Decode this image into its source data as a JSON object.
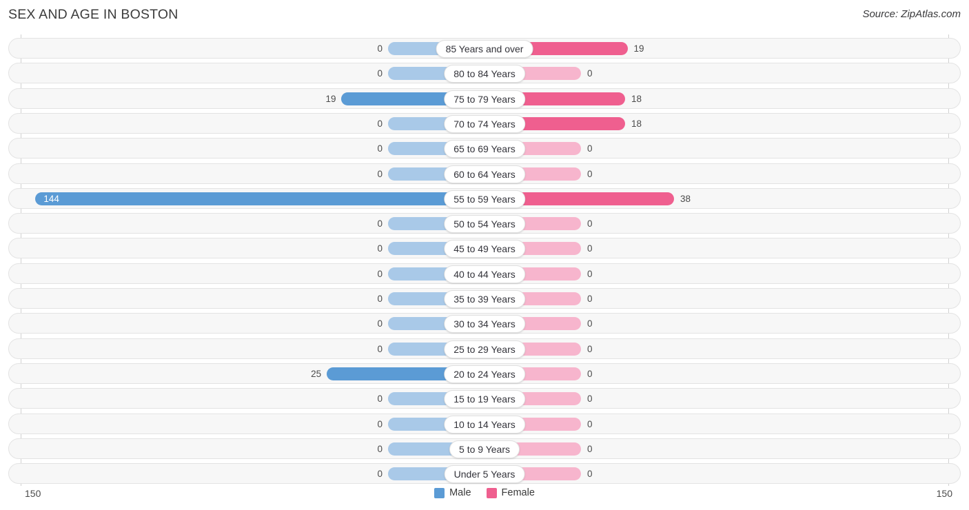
{
  "header": {
    "title": "SEX AND AGE IN BOSTON",
    "source": "Source: ZipAtlas.com"
  },
  "axis": {
    "left_label": "150",
    "right_label": "150",
    "max": 150
  },
  "legend": [
    {
      "label": "Male",
      "color": "#5b9bd5",
      "name": "legend-male"
    },
    {
      "label": "Female",
      "color": "#ef5f8f",
      "name": "legend-female"
    }
  ],
  "colors": {
    "male_strong": "#5b9bd5",
    "male_light": "#a9c9e8",
    "female_strong": "#ef5f8f",
    "female_light": "#f7b5cd",
    "row_bg": "#f7f7f7",
    "row_border": "#e3e3e3",
    "axis": "#d0d0d0"
  },
  "chart_data": {
    "type": "bar",
    "subtype": "population-pyramid",
    "title": "SEX AND AGE IN BOSTON",
    "xlabel": "",
    "ylabel": "",
    "xlim": [
      -150,
      150
    ],
    "grid": false,
    "legend_position": "bottom-center",
    "categories": [
      "85 Years and over",
      "80 to 84 Years",
      "75 to 79 Years",
      "70 to 74 Years",
      "65 to 69 Years",
      "60 to 64 Years",
      "55 to 59 Years",
      "50 to 54 Years",
      "45 to 49 Years",
      "40 to 44 Years",
      "35 to 39 Years",
      "30 to 34 Years",
      "25 to 29 Years",
      "20 to 24 Years",
      "15 to 19 Years",
      "10 to 14 Years",
      "5 to 9 Years",
      "Under 5 Years"
    ],
    "series": [
      {
        "name": "Male",
        "color": "#5b9bd5",
        "values": [
          0,
          0,
          19,
          0,
          0,
          0,
          144,
          0,
          0,
          0,
          0,
          0,
          0,
          25,
          0,
          0,
          0,
          0
        ]
      },
      {
        "name": "Female",
        "color": "#ef5f8f",
        "values": [
          19,
          0,
          18,
          18,
          0,
          0,
          38,
          0,
          0,
          0,
          0,
          0,
          0,
          0,
          0,
          0,
          0,
          0
        ]
      }
    ]
  }
}
